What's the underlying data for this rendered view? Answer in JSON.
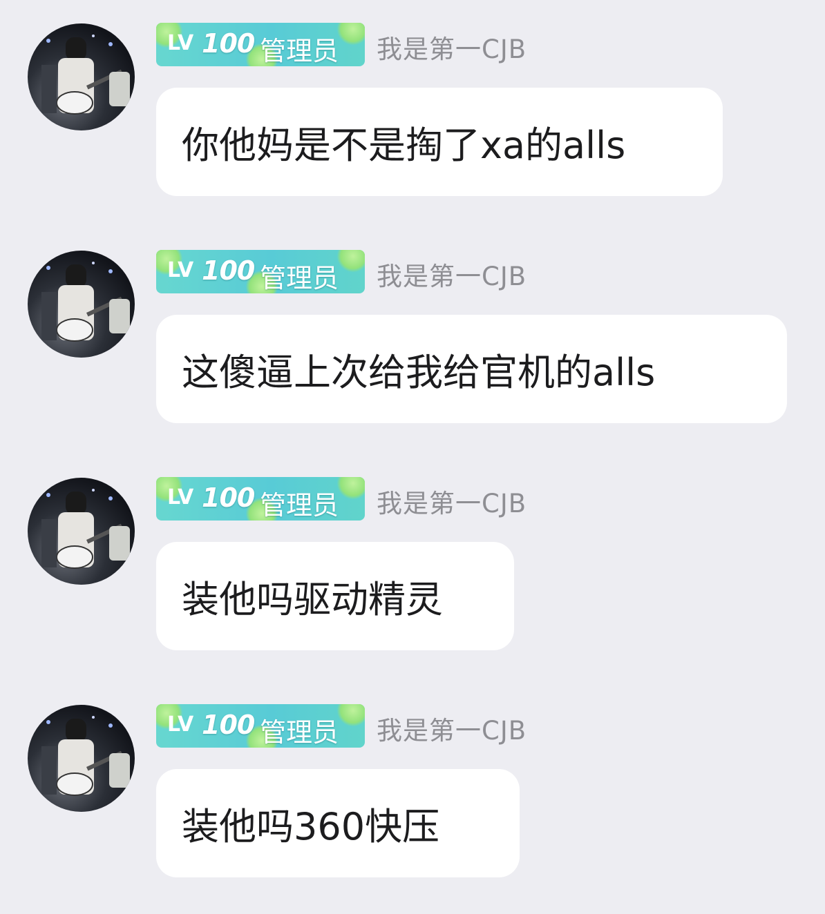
{
  "messages": [
    {
      "badge_level": "100",
      "badge_lv": "LV",
      "badge_role": "管理员",
      "username": "我是第一CJB",
      "text": "你他妈是不是掏了xa的alls"
    },
    {
      "badge_level": "100",
      "badge_lv": "LV",
      "badge_role": "管理员",
      "username": "我是第一CJB",
      "text": "这傻逼上次给我给官机的alls"
    },
    {
      "badge_level": "100",
      "badge_lv": "LV",
      "badge_role": "管理员",
      "username": "我是第一CJB",
      "text": "装他吗驱动精灵"
    },
    {
      "badge_level": "100",
      "badge_lv": "LV",
      "badge_role": "管理员",
      "username": "我是第一CJB",
      "text": "装他吗360快压"
    }
  ],
  "colors": {
    "background": "#ededf2",
    "bubble": "#ffffff",
    "badge": "#5fd2d2",
    "username": "#8e8e93",
    "message_text": "#1c1c1e"
  }
}
